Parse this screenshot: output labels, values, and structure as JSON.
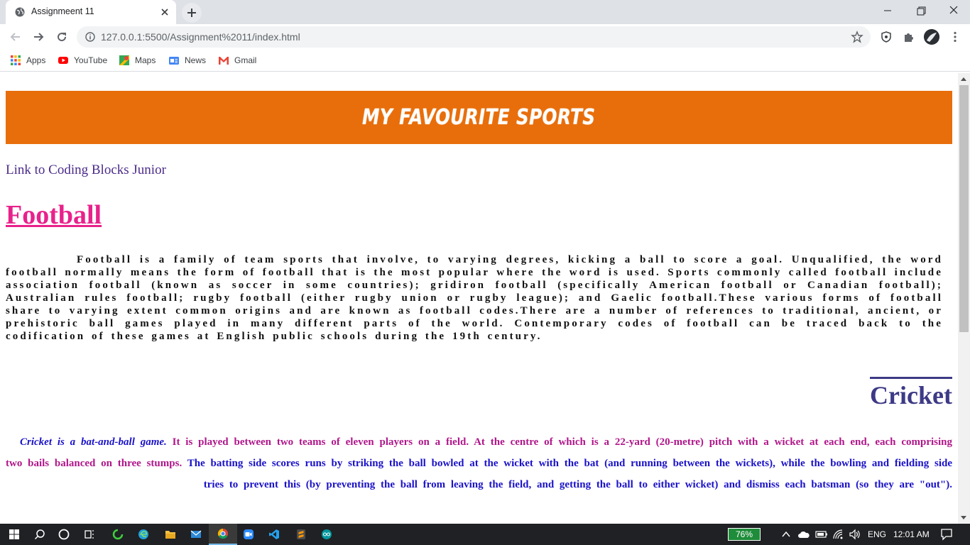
{
  "browser": {
    "tab_title": "Assignmeent 11",
    "url": "127.0.0.1:5500/Assignment%2011/index.html",
    "bookmarks": [
      "Apps",
      "YouTube",
      "Maps",
      "News",
      "Gmail"
    ]
  },
  "page": {
    "banner_title": "MY FAVOURITE SPORTS",
    "link_text": "Link to Coding Blocks Junior",
    "football": {
      "heading": "Football",
      "paragraph": "Football is a family of team sports that involve, to varying degrees, kicking a ball to score a goal. Unqualified, the word football normally means the form of football that is the most popular where the word is used. Sports commonly called football include association football (known as soccer in some countries); gridiron football (specifically American football or Canadian football); Australian rules football; rugby football (either rugby union or rugby league); and Gaelic football.These various forms of football share to varying extent common origins and are known as football codes.There are a number of references to traditional, ancient, or prehistoric ball games played in many different parts of the world. Contemporary codes of football can be traced back to the codification of these games at English public schools during the 19th century."
    },
    "cricket": {
      "heading": "Cricket",
      "part1": "Cricket is a bat-and-ball game.",
      "part2": "It is played between two teams of eleven players on a field. At the centre of which is a 22-yard (20-metre) pitch with a wicket at each end, each comprising two bails balanced on three stumps.",
      "part3": "The batting side scores runs by striking the ball bowled at the wicket with the bat (and running between the wickets), while the bowling and fielding side tries to prevent this (by preventing the ball from leaving the field, and getting the ball to either wicket) and dismiss each batsman (so they are \"out\")."
    }
  },
  "taskbar": {
    "battery": "76%",
    "language": "ENG",
    "time": "12:01 AM"
  },
  "colors": {
    "banner": "#e86e0b",
    "football_heading": "#e8228b",
    "cricket_heading": "#3d3a86",
    "link": "#4b2b8a"
  }
}
